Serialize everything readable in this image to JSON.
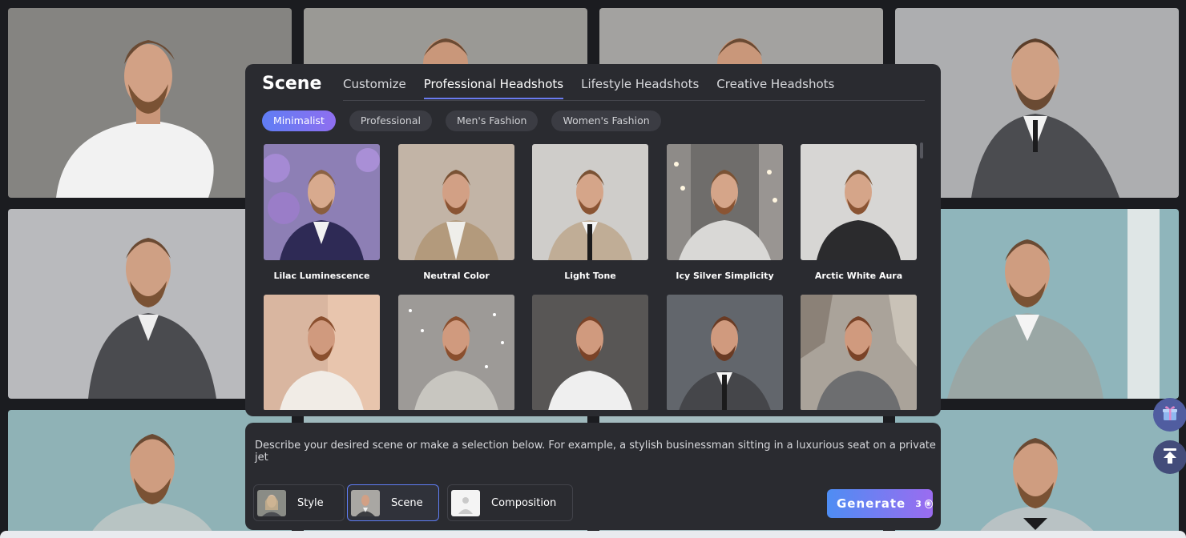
{
  "panel": {
    "title": "Scene",
    "tabs": [
      {
        "label": "Customize"
      },
      {
        "label": "Professional Headshots"
      },
      {
        "label": "Lifestyle Headshots"
      },
      {
        "label": "Creative Headshots"
      }
    ],
    "active_tab": "Professional Headshots",
    "chips": [
      {
        "label": "Minimalist"
      },
      {
        "label": "Professional"
      },
      {
        "label": "Men's Fashion"
      },
      {
        "label": "Women's Fashion"
      }
    ],
    "active_chip": "Minimalist",
    "scenes": [
      {
        "label": "Lilac Luminescence"
      },
      {
        "label": "Neutral Color"
      },
      {
        "label": "Light Tone"
      },
      {
        "label": "Icy Silver Simplicity"
      },
      {
        "label": "Arctic White Aura"
      }
    ]
  },
  "prompt": {
    "placeholder": "Describe your desired scene or make a selection below. For example, a stylish businessman sitting in a luxurious seat on a private jet"
  },
  "options": {
    "style_label": "Style",
    "scene_label": "Scene",
    "composition_label": "Composition"
  },
  "generate": {
    "label": "Generate",
    "cost": "3"
  },
  "colors": {
    "accent_start": "#5f7df4",
    "accent_end": "#9b6cf0",
    "panel_bg": "#2a2b30"
  },
  "icons": {
    "gift": "gift-icon",
    "back_to_top": "arrow-up-to-line-icon",
    "coin": "coin-icon"
  }
}
